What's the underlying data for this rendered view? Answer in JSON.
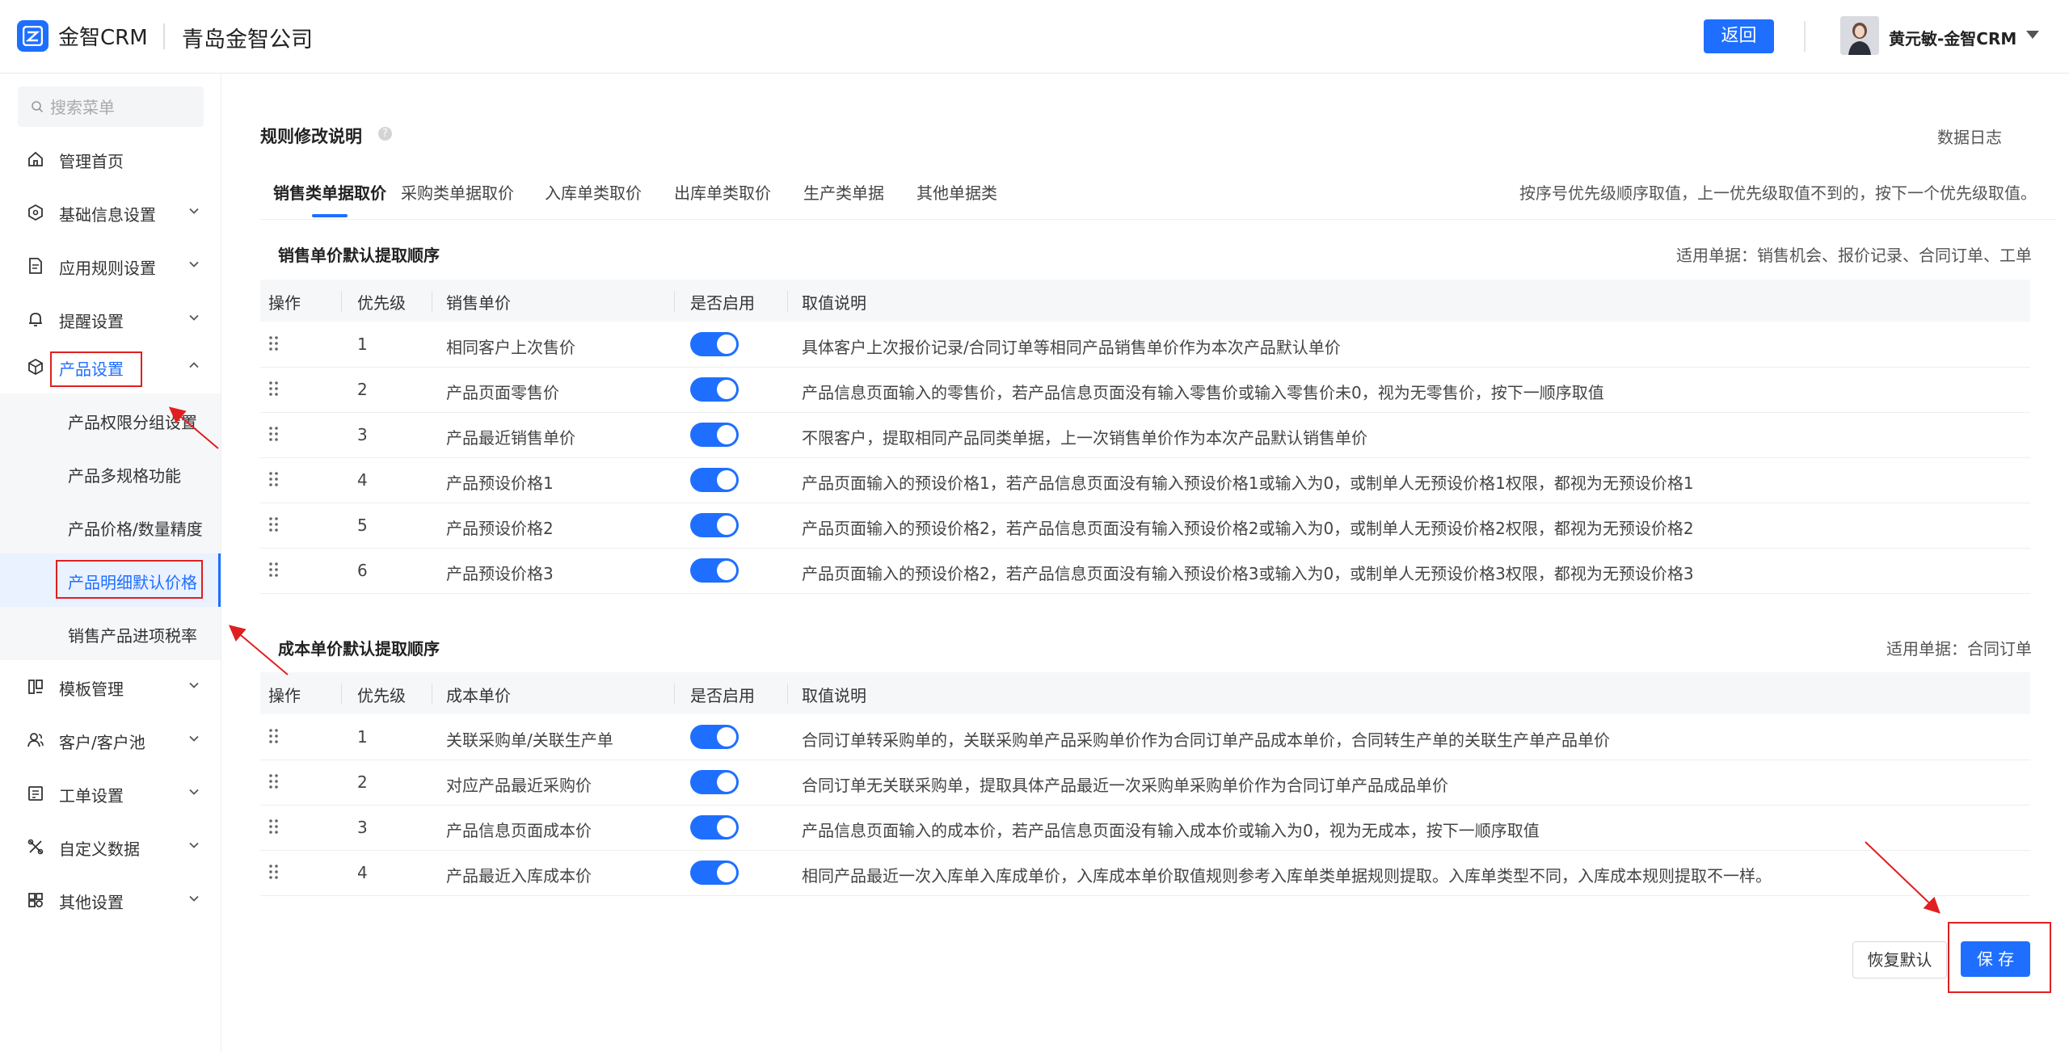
{
  "header": {
    "brand": "金智CRM",
    "company": "青岛金智公司",
    "back_label": "返回",
    "user_name": "黄元敏-金智CRM"
  },
  "sidebar": {
    "search_placeholder": "搜索菜单",
    "items": [
      {
        "label": "管理首页",
        "icon": "home-icon"
      },
      {
        "label": "基础信息设置",
        "icon": "cube-icon"
      },
      {
        "label": "应用规则设置",
        "icon": "document-icon"
      },
      {
        "label": "提醒设置",
        "icon": "bell-icon"
      },
      {
        "label": "产品设置",
        "icon": "product-icon"
      },
      {
        "label": "模板管理",
        "icon": "template-icon"
      },
      {
        "label": "客户/客户池",
        "icon": "customers-icon"
      },
      {
        "label": "工单设置",
        "icon": "workorder-icon"
      },
      {
        "label": "自定义数据",
        "icon": "custom-data-icon"
      },
      {
        "label": "其他设置",
        "icon": "apps-icon"
      }
    ],
    "sub_items": [
      {
        "label": "产品权限分组设置"
      },
      {
        "label": "产品多规格功能"
      },
      {
        "label": "产品价格/数量精度"
      },
      {
        "label": "产品明细默认价格"
      },
      {
        "label": "销售产品进项税率"
      }
    ]
  },
  "main": {
    "title": "规则修改说明",
    "data_log": "数据日志",
    "tabs": [
      {
        "label": "销售类单据取价"
      },
      {
        "label": "采购类单据取价"
      },
      {
        "label": "入库单类取价"
      },
      {
        "label": "出库单类取价"
      },
      {
        "label": "生产类单据"
      },
      {
        "label": "其他单据类"
      }
    ],
    "tab_hint": "按序号优先级顺序取值，上一优先级取值不到的，按下一个优先级取值。",
    "sales": {
      "title": "销售单价默认提取顺序",
      "note": "适用单据：销售机会、报价记录、合同订单、工单",
      "headers": [
        "操作",
        "优先级",
        "销售单价",
        "是否启用",
        "取值说明"
      ],
      "rows": [
        {
          "priority": "1",
          "name": "相同客户上次售价",
          "enabled": true,
          "desc": "具体客户上次报价记录/合同订单等相同产品销售单价作为本次产品默认单价"
        },
        {
          "priority": "2",
          "name": "产品页面零售价",
          "enabled": true,
          "desc": "产品信息页面输入的零售价，若产品信息页面没有输入零售价或输入零售价未0，视为无零售价，按下一顺序取值"
        },
        {
          "priority": "3",
          "name": "产品最近销售单价",
          "enabled": true,
          "desc": "不限客户，提取相同产品同类单据，上一次销售单价作为本次产品默认销售单价"
        },
        {
          "priority": "4",
          "name": "产品预设价格1",
          "enabled": true,
          "desc": "产品页面输入的预设价格1，若产品信息页面没有输入预设价格1或输入为0，或制单人无预设价格1权限，都视为无预设价格1"
        },
        {
          "priority": "5",
          "name": "产品预设价格2",
          "enabled": true,
          "desc": "产品页面输入的预设价格2，若产品信息页面没有输入预设价格2或输入为0，或制单人无预设价格2权限，都视为无预设价格2"
        },
        {
          "priority": "6",
          "name": "产品预设价格3",
          "enabled": true,
          "desc": "产品页面输入的预设价格2，若产品信息页面没有输入预设价格3或输入为0，或制单人无预设价格3权限，都视为无预设价格3"
        }
      ]
    },
    "cost": {
      "title": "成本单价默认提取顺序",
      "note": "适用单据：合同订单",
      "headers": [
        "操作",
        "优先级",
        "成本单价",
        "是否启用",
        "取值说明"
      ],
      "rows": [
        {
          "priority": "1",
          "name": "关联采购单/关联生产单",
          "enabled": true,
          "desc": "合同订单转采购单的，关联采购单产品采购单价作为合同订单产品成本单价，合同转生产单的关联生产单产品单价"
        },
        {
          "priority": "2",
          "name": "对应产品最近采购价",
          "enabled": true,
          "desc": "合同订单无关联采购单，提取具体产品最近一次采购单采购单价作为合同订单产品成品单价"
        },
        {
          "priority": "3",
          "name": "产品信息页面成本价",
          "enabled": true,
          "desc": "产品信息页面输入的成本价，若产品信息页面没有输入成本价或输入为0，视为无成本，按下一顺序取值"
        },
        {
          "priority": "4",
          "name": "产品最近入库成本价",
          "enabled": true,
          "desc": "相同产品最近一次入库单入库成单价，入库成本单价取值规则参考入库单类单据规则提取。入库单类型不同，入库成本规则提取不一样。"
        }
      ]
    },
    "restore_label": "恢复默认",
    "save_label": "保 存"
  },
  "colors": {
    "accent": "#1e6fff",
    "annotation": "#e02020"
  }
}
